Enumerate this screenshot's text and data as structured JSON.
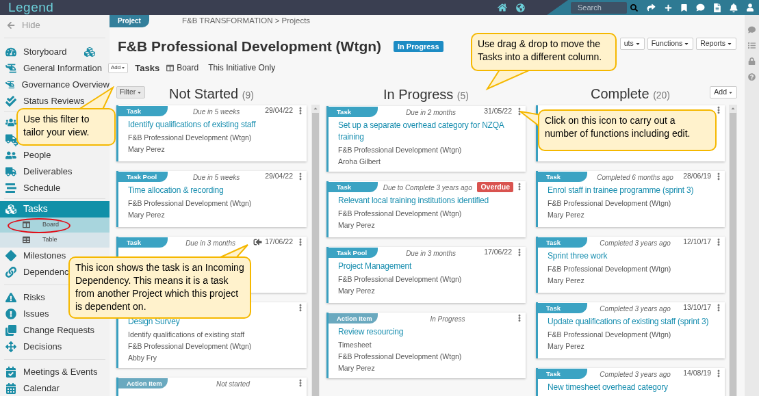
{
  "app": {
    "logo": "Legend",
    "search": {
      "placeholder": "Search"
    }
  },
  "sidebar": {
    "hide": "Hide",
    "groups": [
      [
        {
          "kind": "item",
          "label": "Storyboard",
          "selected": false
        },
        {
          "kind": "item",
          "label": "General Information",
          "selected": false
        },
        {
          "kind": "item",
          "label": "Governance Overview",
          "selected": false
        },
        {
          "kind": "item",
          "label": "Status Reviews",
          "selected": false
        }
      ],
      [
        {
          "kind": "covered"
        },
        {
          "kind": "covered"
        },
        {
          "kind": "item",
          "label": "People",
          "selected": false
        },
        {
          "kind": "item",
          "label": "Deliverables",
          "selected": false
        },
        {
          "kind": "item",
          "label": "Schedule",
          "selected": false
        }
      ],
      [
        {
          "kind": "item",
          "label": "Tasks",
          "selected": true,
          "children": [
            {
              "label": "Board",
              "selected": true
            },
            {
              "label": "Table",
              "selected": false
            }
          ]
        },
        {
          "kind": "item",
          "label": "Milestones",
          "selected": false
        },
        {
          "kind": "item",
          "label": "Dependenc",
          "selected": false
        }
      ],
      [
        {
          "kind": "item",
          "label": "Risks",
          "selected": false
        },
        {
          "kind": "item",
          "label": "Issues",
          "selected": false
        },
        {
          "kind": "item",
          "label": "Change Requests",
          "selected": false
        },
        {
          "kind": "item",
          "label": "Decisions",
          "selected": false
        }
      ],
      [
        {
          "kind": "item",
          "label": "Meetings & Events",
          "selected": false
        },
        {
          "kind": "item",
          "label": "Calendar",
          "selected": false
        }
      ]
    ]
  },
  "header": {
    "tab": "Project",
    "breadcrumb": "F&B TRANSFORMATION > Projects",
    "title": "F&B Professional Development (Wtgn)",
    "status": "In Progress",
    "buttons": [
      "uts",
      "Functions",
      "Reports"
    ],
    "add": "Add",
    "module": "Tasks",
    "view": "Board",
    "scope": "This Initiative Only"
  },
  "board": {
    "filter": "Filter",
    "add": "Add",
    "columns": [
      {
        "title": "Not Started",
        "count": "(9)",
        "cards": [
          {
            "kind": "card",
            "tag": {
              "label": "Task",
              "color": "#3ba3c3"
            },
            "status": "Due in 5 weeks",
            "date": "29/04/22",
            "incoming": false,
            "title": "Identify qualifications of existing staff",
            "lines": [
              "F&B Professional Development (Wtgn)",
              "Mary Perez"
            ]
          },
          {
            "kind": "card",
            "tag": {
              "label": "Task Pool",
              "color": "#3ba3c3"
            },
            "status": "Due in 5 weeks",
            "date": "29/04/22",
            "incoming": false,
            "title": "Time allocation & recording",
            "lines": [
              "F&B Professional Development (Wtgn)",
              "Mary Perez"
            ]
          },
          {
            "kind": "card",
            "tag": {
              "label": "Task",
              "color": "#3ba3c3"
            },
            "status": "Due in 3 months",
            "date": "17/06/22",
            "incoming": true
          },
          {
            "kind": "card",
            "title": "Design Survey",
            "lines": [
              "Identify qualifications of existing staff",
              "F&B Professional Development (Wtgn)",
              "Abby Fry"
            ]
          },
          {
            "kind": "card",
            "tag": {
              "label": "Action Item",
              "color": "#6aa9bf"
            },
            "status": "Not started",
            "incoming": false
          }
        ]
      },
      {
        "title": "In Progress",
        "count": "(5)",
        "cards": [
          {
            "kind": "card",
            "tag": {
              "label": "Task",
              "color": "#3ba3c3"
            },
            "status": "Due in 2 months",
            "date": "31/05/22",
            "incoming": false,
            "title": "Set up a separate overhead category for NZQA training",
            "lines": [
              "F&B Professional Development (Wtgn)",
              "Aroha Gilbert"
            ]
          },
          {
            "kind": "card",
            "tag": {
              "label": "Task",
              "color": "#3ba3c3"
            },
            "status": "Due to Complete 3 years ago",
            "overdue": "Overdue",
            "incoming": false,
            "title": "Relevant local training institutions identified",
            "lines": [
              "F&B Professional Development (Wtgn)",
              "Mary Perez"
            ]
          },
          {
            "kind": "card",
            "tag": {
              "label": "Task Pool",
              "color": "#3ba3c3"
            },
            "status": "Due in 3 months",
            "date": "17/06/22",
            "incoming": false,
            "title": "Project Management",
            "lines": [
              "F&B Professional Development (Wtgn)",
              "Mary Perez"
            ]
          },
          {
            "kind": "card",
            "tag": {
              "label": "Action Item",
              "color": "#6aa9bf"
            },
            "status": "In Progress",
            "incoming": false,
            "title": "Review resourcing",
            "lines": [
              "Timesheet",
              "F&B Professional Development (Wtgn)",
              "Mary Perez"
            ]
          }
        ]
      },
      {
        "title": "Complete",
        "count": "(20)",
        "cards": [
          {
            "kind": "covered"
          },
          {
            "kind": "card",
            "tag": {
              "label": "Task",
              "color": "#3ba3c3"
            },
            "status": "Completed 6 months ago",
            "date": "28/06/19",
            "incoming": false,
            "title": "Enrol staff in trainee programme (sprint 3)",
            "lines": [
              "F&B Professional Development (Wtgn)",
              "Mary Perez"
            ]
          },
          {
            "kind": "card",
            "tag": {
              "label": "Task",
              "color": "#3ba3c3"
            },
            "status": "Completed 3 years ago",
            "date": "12/10/17",
            "incoming": false,
            "title": "Sprint three work",
            "lines": [
              "F&B Professional Development (Wtgn)",
              "Mary Perez"
            ]
          },
          {
            "kind": "card",
            "tag": {
              "label": "Task",
              "color": "#3ba3c3"
            },
            "status": "Completed 3 years ago",
            "date": "13/10/17",
            "incoming": false,
            "title": "Update qualifications of existing staff (sprint 3)",
            "lines": [
              "F&B Professional Development (Wtgn)",
              "Mary Perez"
            ]
          },
          {
            "kind": "card",
            "tag": {
              "label": "Task",
              "color": "#3ba3c3"
            },
            "status": "Completed 3 years ago",
            "date": "14/08/19",
            "incoming": false,
            "title": "New timesheet overhead category"
          }
        ]
      }
    ]
  },
  "callouts": [
    "Use this filter to tailor your view.",
    "Use drag & drop to move the Tasks into a different column.",
    "Click on this icon to carry out a number of functions including edit.",
    "This icon shows the task is an Incoming Dependency. This means it is a task from another Project which this project is dependent on."
  ]
}
